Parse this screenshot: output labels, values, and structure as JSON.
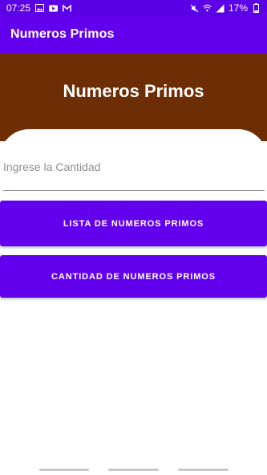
{
  "status_bar": {
    "time": "07:25",
    "battery": "17%",
    "left_icons": [
      "image-icon",
      "youtube-icon",
      "gmail-icon"
    ],
    "right_icons": [
      "mute-icon",
      "wifi-icon",
      "signal-icon",
      "battery-icon"
    ]
  },
  "app_bar": {
    "title": "Numeros Primos"
  },
  "header": {
    "title": "Numeros Primos",
    "background_color": "#6d2e05"
  },
  "form": {
    "quantity_placeholder": "Ingrese la Cantidad",
    "quantity_value": ""
  },
  "buttons": {
    "list_label": "LISTA DE NUMEROS PRIMOS",
    "count_label": "CANTIDAD DE NUMEROS PRIMOS"
  },
  "colors": {
    "primary": "#6200ee",
    "status_bar": "#5b00e6"
  }
}
